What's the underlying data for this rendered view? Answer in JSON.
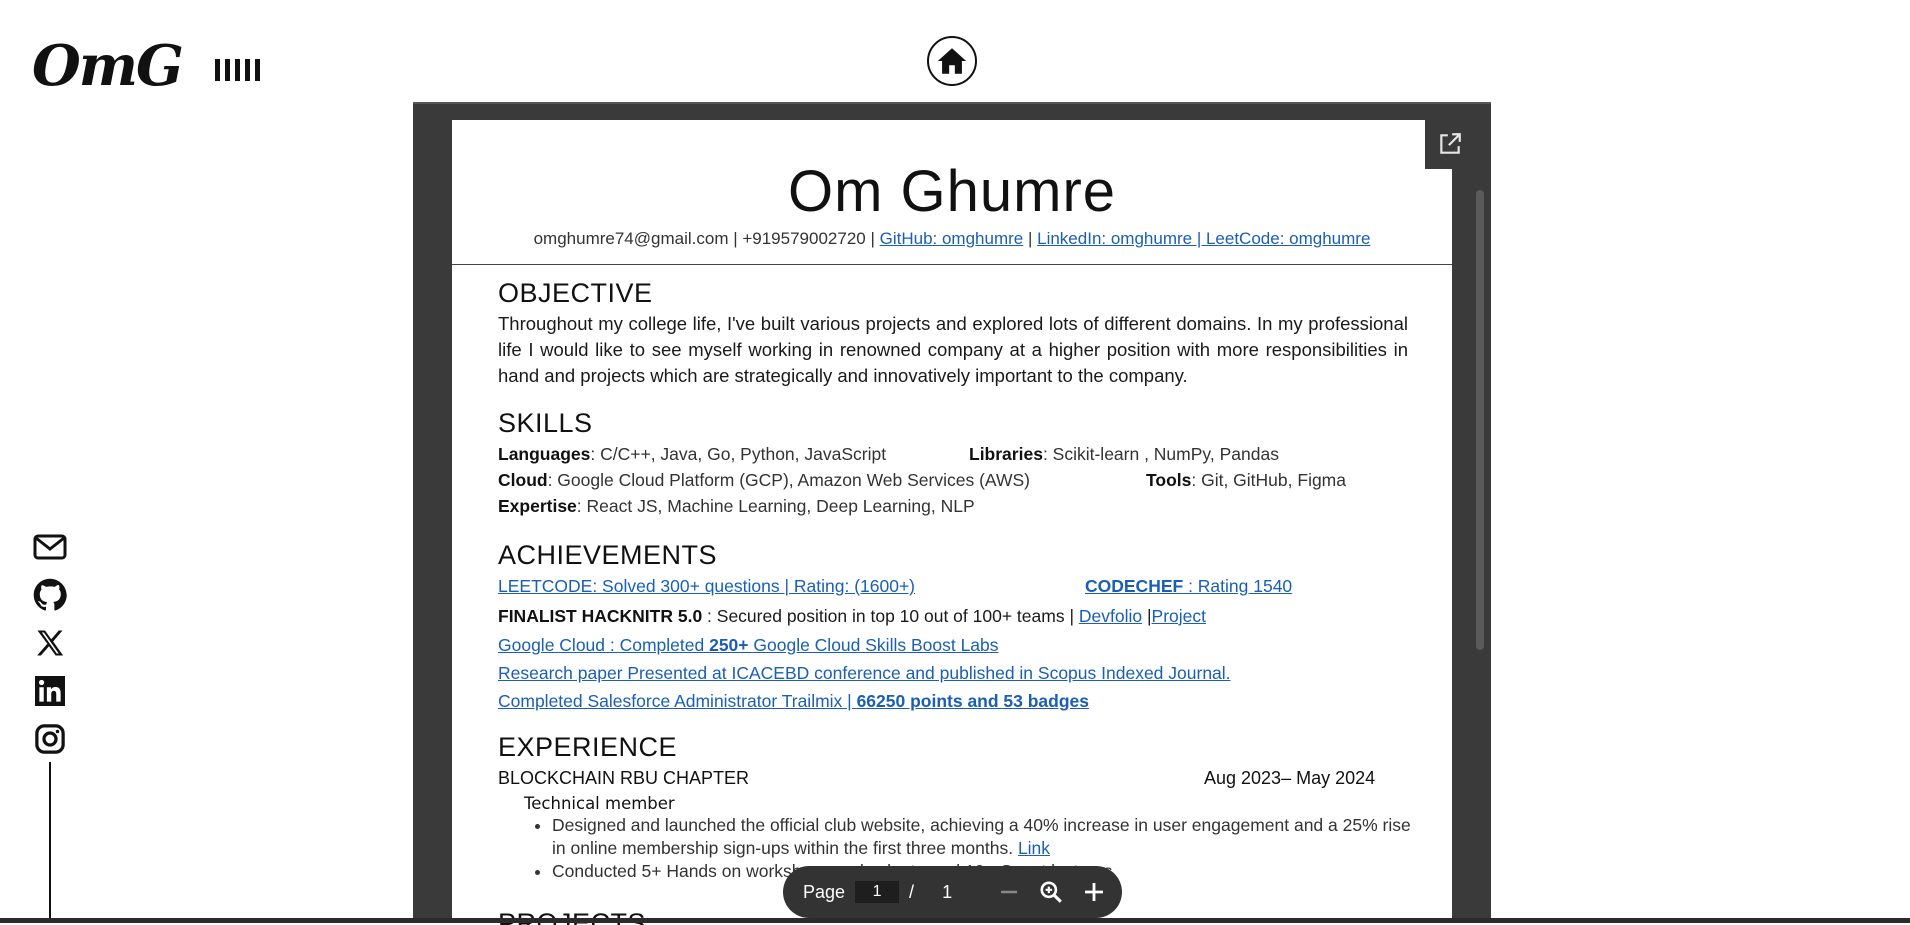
{
  "site": {
    "logo_text": "OmG",
    "menu_icon": "bars-icon",
    "home_icon": "home-icon",
    "social": [
      "mail-icon",
      "github-icon",
      "x-icon",
      "linkedin-icon",
      "instagram-icon"
    ]
  },
  "viewer": {
    "open_external_icon": "open-in-new-icon",
    "toolbar": {
      "page_label": "Page",
      "current_page": "1",
      "separator": "/",
      "total_pages": "1",
      "zoom_out_icon": "minus-icon",
      "zoom_icon": "zoom-icon",
      "zoom_in_icon": "plus-icon"
    }
  },
  "resume": {
    "name": "Om Ghumre",
    "contact": {
      "email_phone": "omghumre74@gmail.com | +919579002720 |",
      "github": "GitHub: omghumre",
      "sep": "|",
      "linkedin_leetcode": "LinkedIn: omghumre | LeetCode: omghumre"
    },
    "objective": {
      "title": "OBJECTIVE",
      "text": "Throughout my college life, I've built various projects and explored lots of different domains. In my professional life I would like to see myself working in renowned company at a higher position with more responsibilities in hand and projects which are strategically and innovatively important to the company."
    },
    "skills": {
      "title": "SKILLS",
      "languages_label": "Languages",
      "languages": ": C/C++, Java, Go, Python, JavaScript",
      "libraries_label": "Libraries",
      "libraries": ": Scikit-learn , NumPy, Pandas",
      "cloud_label": "Cloud",
      "cloud": ": Google Cloud Platform (GCP), Amazon Web Services (AWS)",
      "tools_label": "Tools",
      "tools": ": Git, GitHub, Figma",
      "expertise_label": "Expertise",
      "expertise": ": React JS, Machine Learning, Deep Learning, NLP"
    },
    "achievements": {
      "title": "ACHIEVEMENTS",
      "leetcode": "LEETCODE:  Solved 300+ questions | Rating: (1600+)",
      "codechef_label": "CODECHEF",
      "codechef": " : Rating 1540",
      "hacknitr_label": "FINALIST HACKNITR 5.0",
      "hacknitr": " : Secured position in top 10 out of 100+ teams |",
      "devfolio": "Devfolio",
      "project_sep": "|",
      "project": "Project",
      "gcloud_pre": "Google Cloud : Completed ",
      "gcloud_bold": "250+",
      "gcloud_post": " Google Cloud Skills Boost Labs",
      "research": "Research paper Presented at ICACEBD conference and published in Scopus Indexed Journal.",
      "salesforce_pre": "Completed Salesforce Administrator Trailmix | ",
      "salesforce_bold": "66250 points and 53 badges"
    },
    "experience": {
      "title": "EXPERIENCE",
      "org": "BLOCKCHAIN RBU CHAPTER",
      "dates": "Aug 2023– May 2024",
      "role": "Technical member",
      "bullet1": "Designed and launched the official club website, achieving a 40% increase in user engagement and a 25% rise in online membership sign-ups within the first three months.",
      "bullet1_link": "Link",
      "bullet2": "Conducted 5+ Hands on workshops and volunteered 10+ Guest lectures"
    },
    "projects": {
      "title": "PROJECTS"
    }
  }
}
